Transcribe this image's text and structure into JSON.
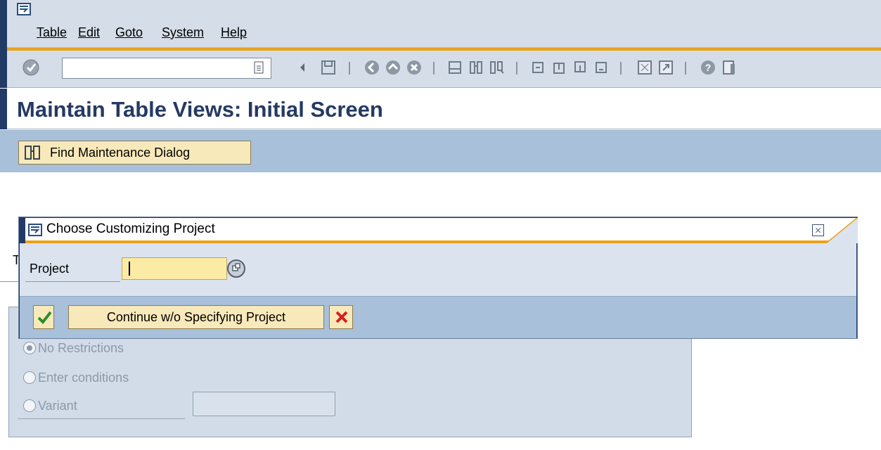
{
  "menu": {
    "items": [
      {
        "label": "Table"
      },
      {
        "label": "Edit"
      },
      {
        "label": "Goto"
      },
      {
        "label": "System"
      },
      {
        "label": "Help"
      }
    ]
  },
  "toolbar": {
    "command_value": "",
    "icons": [
      "enter-icon",
      "back-icon",
      "save-icon",
      "back-green-icon",
      "exit-icon",
      "cancel-icon",
      "print-icon",
      "find-icon",
      "find-next-icon",
      "first-page-icon",
      "previous-page-icon",
      "next-page-icon",
      "last-page-icon",
      "create-session-icon",
      "shortcut-icon",
      "help-icon",
      "layout-icon"
    ]
  },
  "title": {
    "text": "Maintain Table Views: Initial Screen"
  },
  "app_toolbar": {
    "find_maintenance_dialog": "Find Maintenance Dialog"
  },
  "background": {
    "partial_label": "T",
    "restrictions": [
      {
        "label": "No Restrictions",
        "selected": true
      },
      {
        "label": "Enter conditions",
        "selected": false
      },
      {
        "label": "Variant",
        "selected": false
      }
    ]
  },
  "dialog": {
    "title": "Choose Customizing Project",
    "project_label": "Project",
    "project_value": "",
    "continue_label": "Continue w/o Specifying Project"
  },
  "colors": {
    "accent": "#e8a217",
    "title": "#243a63",
    "button_bg": "#f8e9ba",
    "panel": "#a8c0d9"
  }
}
